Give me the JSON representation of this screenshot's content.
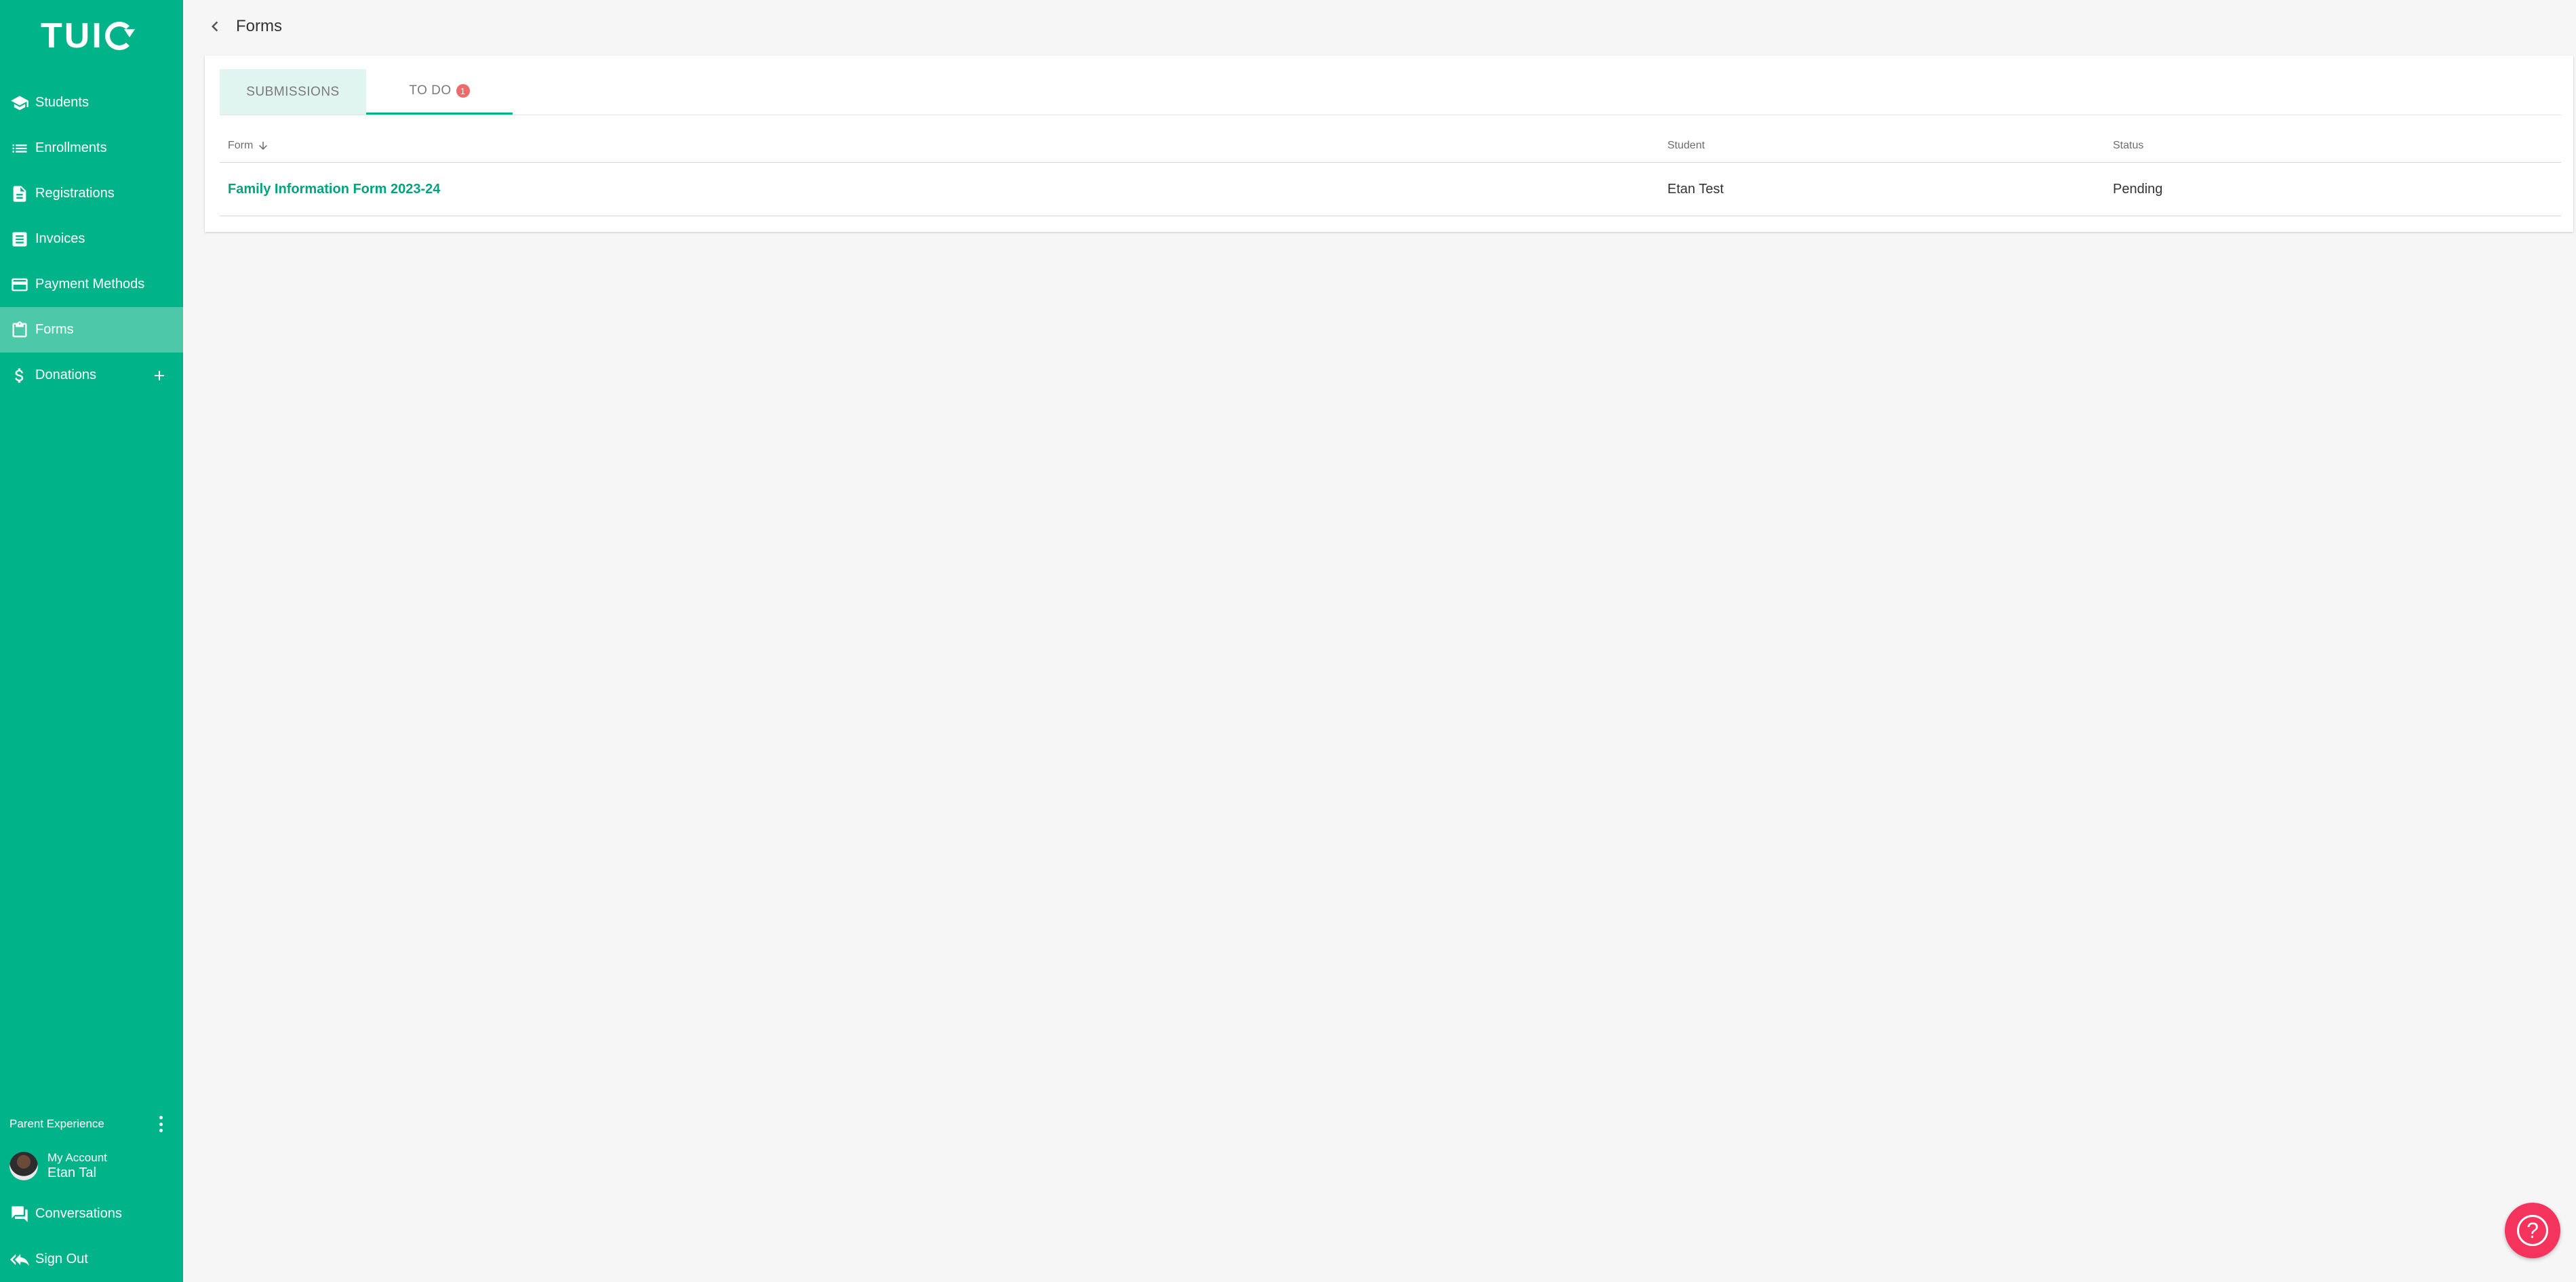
{
  "app": {
    "logo_text": "TUI"
  },
  "sidebar": {
    "items": [
      {
        "label": "Students",
        "icon": "graduation-cap-icon"
      },
      {
        "label": "Enrollments",
        "icon": "list-icon"
      },
      {
        "label": "Registrations",
        "icon": "document-icon"
      },
      {
        "label": "Invoices",
        "icon": "receipt-icon"
      },
      {
        "label": "Payment Methods",
        "icon": "credit-card-icon"
      },
      {
        "label": "Forms",
        "icon": "clipboard-icon",
        "active": true
      },
      {
        "label": "Donations",
        "icon": "dollar-icon"
      }
    ],
    "experience_label": "Parent Experience",
    "account": {
      "title": "My Account",
      "name": "Etan Tal"
    },
    "conversations_label": "Conversations",
    "signout_label": "Sign Out"
  },
  "header": {
    "title": "Forms"
  },
  "tabs": [
    {
      "label": "SUBMISSIONS"
    },
    {
      "label": "TO DO",
      "badge": "1"
    }
  ],
  "table": {
    "columns": [
      "Form",
      "Student",
      "Status"
    ],
    "rows": [
      {
        "form": "Family Information Form 2023-24",
        "student": "Etan Test",
        "status": "Pending"
      }
    ]
  },
  "help": {
    "symbol": "?"
  },
  "colors": {
    "brand": "#00b388",
    "active_nav": "#4dc9aa",
    "badge": "#ef6b6b",
    "help_fab": "#f4345c",
    "link": "#00a37a"
  }
}
